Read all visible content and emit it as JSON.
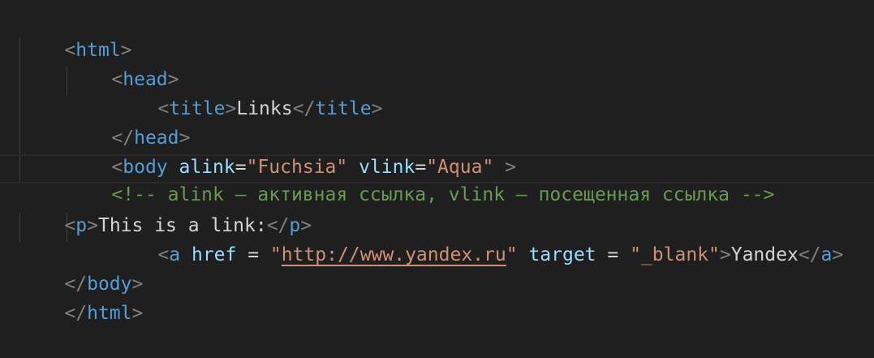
{
  "lines": {
    "l1": {
      "open": "<",
      "tag": "html",
      "close": ">"
    },
    "l2": {
      "open": "<",
      "tag": "head",
      "close": ">"
    },
    "l3": {
      "open": "<",
      "tag": "title",
      "close": ">",
      "text": "Links",
      "end_open": "</",
      "end_tag": "title",
      "end_close": ">"
    },
    "l4": {
      "open": "</",
      "tag": "head",
      "close": ">"
    },
    "l5": {
      "open": "<",
      "tag": "body",
      "sp1": " ",
      "attr1": "alink",
      "eq1": "=",
      "val1": "\"Fuchsia\"",
      "sp2": " ",
      "attr2": "vlink",
      "eq2": "=",
      "val2": "\"Aqua\"",
      "close": " >"
    },
    "l6": {
      "comment": "<!-- alink – активная ссылка, vlink – посещенная ссылка -->"
    },
    "l7": {
      "open": "<",
      "tag": "p",
      "close": ">",
      "text": "This is a link:",
      "end_open": "</",
      "end_tag": "p",
      "end_close": ">"
    },
    "l8": {
      "open": "<",
      "tag": "a",
      "sp1": " ",
      "attr1": "href",
      "eq1": " = ",
      "q1": "\"",
      "url": "http://www.yandex.ru",
      "q2": "\"",
      "sp2": " ",
      "attr2": "target",
      "eq2": " = ",
      "val2": "\"_blank\"",
      "close": ">",
      "text": "Yandex",
      "end_open": "</",
      "end_tag": "a",
      "end_close": ">"
    },
    "l9": {
      "open": "</",
      "tag": "body",
      "close": ">"
    },
    "l10": {
      "open": "</",
      "tag": "html",
      "close": ">"
    }
  }
}
